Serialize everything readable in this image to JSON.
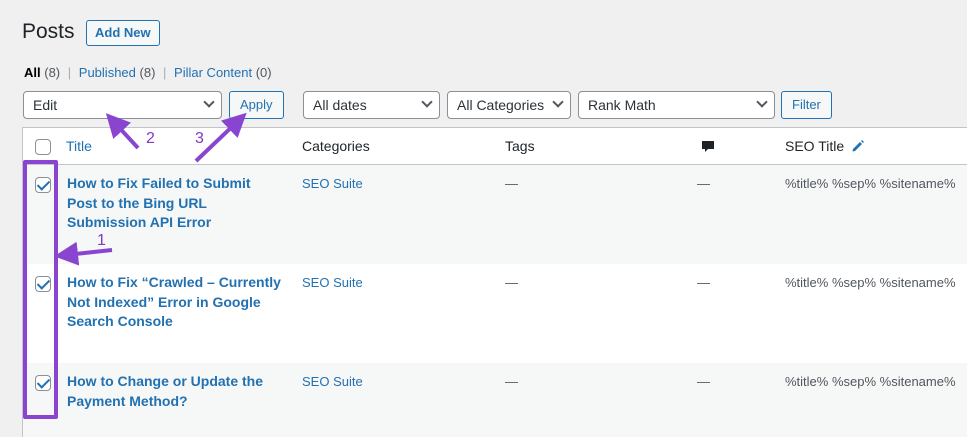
{
  "header": {
    "title": "Posts",
    "add_new_label": "Add New"
  },
  "filters_nav": [
    {
      "label": "All",
      "count": "(8)",
      "current": true
    },
    {
      "label": "Published",
      "count": "(8)",
      "current": false
    },
    {
      "label": "Pillar Content",
      "count": "(0)",
      "current": false
    }
  ],
  "toolbar": {
    "bulk_action_value": "Edit",
    "apply_label": "Apply",
    "date_filter_value": "All dates",
    "category_filter_value": "All Categories",
    "seo_filter_value": "Rank Math",
    "filter_label": "Filter"
  },
  "table": {
    "headers": {
      "title": "Title",
      "categories": "Categories",
      "tags": "Tags",
      "comments_icon": "comment-icon",
      "seo_title": "SEO Title"
    },
    "rows": [
      {
        "title": "How to Fix Failed to Submit Post to the Bing URL Submission API Error",
        "category": "SEO Suite",
        "tags": "—",
        "comments": "—",
        "seo_title": "%title% %sep% %sitename%",
        "checked": true
      },
      {
        "title": "How to Fix “Crawled – Currently Not Indexed” Error in Google Search Console",
        "category": "SEO Suite",
        "tags": "—",
        "comments": "—",
        "seo_title": "%title% %sep% %sitename%",
        "checked": true
      },
      {
        "title": "How to Change or Update the Payment Method?",
        "category": "SEO Suite",
        "tags": "—",
        "comments": "—",
        "seo_title": "%title% %sep% %sitename%",
        "checked": true
      }
    ]
  },
  "annotations": {
    "step1": "1",
    "step2": "2",
    "step3": "3",
    "color": "#8a45d0"
  }
}
